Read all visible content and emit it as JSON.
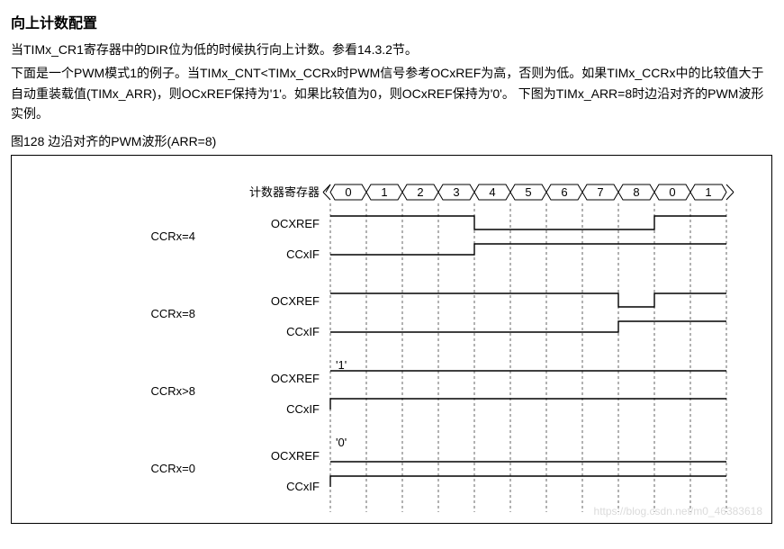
{
  "title": "向上计数配置",
  "para1": "当TIMx_CR1寄存器中的DIR位为低的时候执行向上计数。参看14.3.2节。",
  "para2": "下面是一个PWM模式1的例子。当TIMx_CNT<TIMx_CCRx时PWM信号参考OCxREF为高，否则为低。如果TIMx_CCRx中的比较值大于自动重装载值(TIMx_ARR)，则OCxREF保持为'1'。如果比较值为0，则OCxREF保持为'0'。 下图为TIMx_ARR=8时边沿对齐的PWM波形实例。",
  "figcaption": "图128    边沿对齐的PWM波形(ARR=8)",
  "diagram": {
    "counter_label": "计数器寄存器",
    "counter_values": [
      "0",
      "1",
      "2",
      "3",
      "4",
      "5",
      "6",
      "7",
      "8",
      "0",
      "1"
    ],
    "signal_ocxref": "OCXREF",
    "signal_ccxif": "CCxIF",
    "groups": [
      {
        "label": "CCRx=4",
        "edge_count_index": 4,
        "annot": null,
        "ocxref_mode": "fall_at_edge"
      },
      {
        "label": "CCRx=8",
        "edge_count_index": 8,
        "annot": null,
        "ocxref_mode": "fall_at_edge"
      },
      {
        "label": "CCRx>8",
        "edge_count_index": null,
        "annot": "'1'",
        "ocxref_mode": "always_high"
      },
      {
        "label": "CCRx=0",
        "edge_count_index": null,
        "annot": "'0'",
        "ocxref_mode": "always_low"
      }
    ]
  },
  "chart_data": {
    "type": "timing_diagram",
    "title": "边沿对齐的PWM波形(ARR=8)",
    "counter_sequence": [
      0,
      1,
      2,
      3,
      4,
      5,
      6,
      7,
      8,
      0,
      1
    ],
    "arr": 8,
    "scenarios": [
      {
        "ccrx": 4,
        "ocxref": "high for cnt<4, low for cnt>=4; rises again at overflow",
        "ccxif_set_at_cnt": 4
      },
      {
        "ccrx": 8,
        "ocxref": "high for cnt<8, low for cnt>=8; rises again at overflow",
        "ccxif_set_at_cnt": 8
      },
      {
        "ccrx": ">8",
        "ocxref": "always '1'",
        "ccxif_set_at_cnt": 0
      },
      {
        "ccrx": 0,
        "ocxref": "always '0'",
        "ccxif_set_at_cnt": 0
      }
    ]
  },
  "watermark": "https://blog.csdn.net/m0_46383618"
}
